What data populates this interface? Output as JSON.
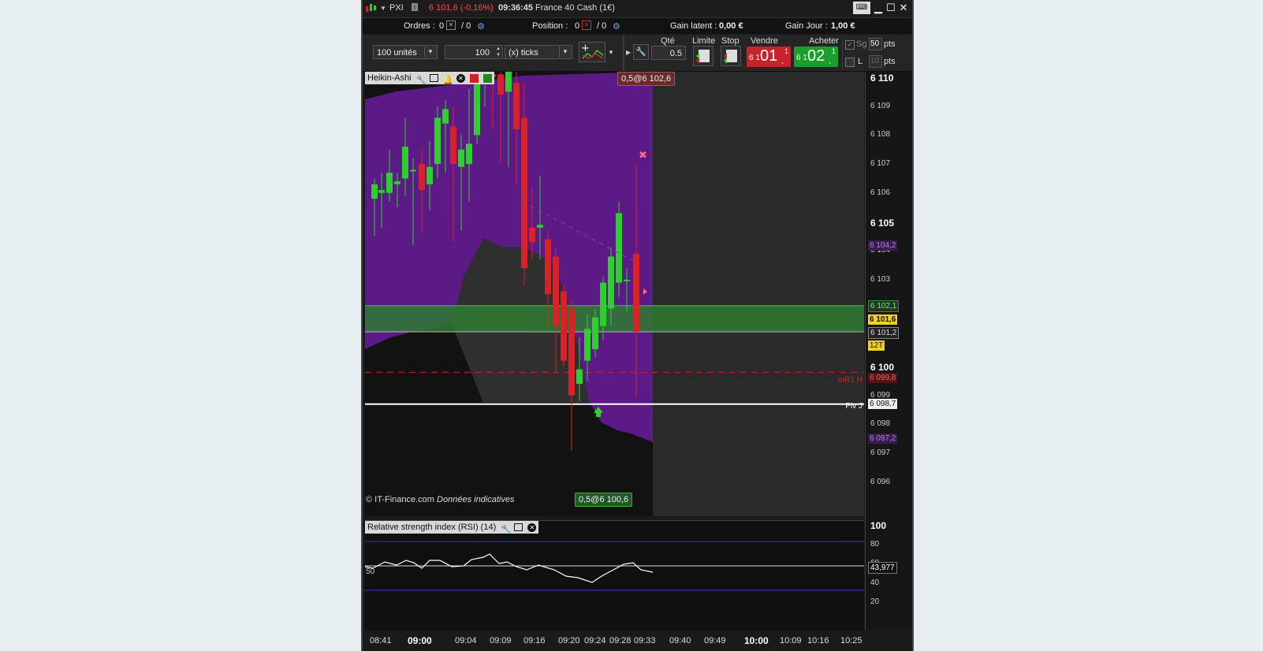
{
  "titlebar": {
    "app": "PXI",
    "price_change": "6 101,6 (-0,16%)",
    "time": "09:36:45",
    "instrument": "France 40 Cash (1€)"
  },
  "status": {
    "orders_label": "Ordres :",
    "orders_a": "0",
    "orders_b": "/ 0",
    "position_label": "Position :",
    "position_a": "0",
    "position_b": "/ 0",
    "gain_latent_label": "Gain latent :",
    "gain_latent_value": "0,00 €",
    "gain_jour_label": "Gain Jour :",
    "gain_jour_value": "1,00 €"
  },
  "toolbar": {
    "units_select": "100 unités",
    "step_value": "100",
    "ticks_select": "(x) ticks",
    "qty_label": "Qté",
    "qty_value": "0.5",
    "limit_label": "Limite",
    "stop_label": "Stop",
    "sell_label": "Vendre",
    "buy_label": "Acheter",
    "sell_prefix": "6 1",
    "sell_big": "01",
    "sell_small": "1",
    "buy_prefix": "6 1",
    "buy_big": "02",
    "buy_small": "1",
    "sg_label": "Sg",
    "sg_value": "50",
    "pts1": "pts",
    "l_label": "L",
    "l_value": "10",
    "pts2": "pts"
  },
  "chart": {
    "indicator_label": "Heikin-Ashi",
    "order_tag_top": "0,5@6 102,6",
    "order_tag_bottom": "0,5@6 100,6",
    "copyright": "© IT-Finance.com",
    "disclaimer": "Données indicatives",
    "mr1_label": "mR1 H",
    "piv_label": "Piv J",
    "colors": {
      "bull": "#2fcf2f",
      "bear": "#d8222a",
      "cloud": "#5b1a85",
      "zone": "#2e7a32"
    }
  },
  "price_axis": {
    "labels": [
      {
        "v": "6 110",
        "bold": true
      },
      {
        "v": "6 109"
      },
      {
        "v": "6 108"
      },
      {
        "v": "6 107"
      },
      {
        "v": "6 106"
      },
      {
        "v": "6 105",
        "bold": true
      },
      {
        "v": "6 104"
      },
      {
        "v": "6 103"
      },
      {
        "v": "6 102"
      },
      {
        "v": "6 101"
      },
      {
        "v": "6 100",
        "bold": true
      },
      {
        "v": "6 099"
      },
      {
        "v": "6 098"
      },
      {
        "v": "6 097"
      },
      {
        "v": "6 096"
      }
    ],
    "box_1042": "6 104,2",
    "box_1021": "6 102,1",
    "box_1016": "6 101,6",
    "box_1012": "6 101,2",
    "timer": "12T",
    "box_0998": "6 099,8",
    "box_0987": "6 098,7",
    "box_0972": "6 097,2"
  },
  "rsi": {
    "label": "Relative strength index (RSI) (14)",
    "level_50": "50",
    "axis": [
      "100",
      "80",
      "60",
      "40",
      "20"
    ],
    "current": "43,977"
  },
  "time_axis": {
    "labels": [
      {
        "v": "08:41"
      },
      {
        "v": "09:00",
        "bold": true
      },
      {
        "v": "09:04"
      },
      {
        "v": "09:09"
      },
      {
        "v": "09:16"
      },
      {
        "v": "09:20"
      },
      {
        "v": "09:24"
      },
      {
        "v": "09:28"
      },
      {
        "v": "09:33"
      },
      {
        "v": "09:40"
      },
      {
        "v": "09:49"
      },
      {
        "v": "10:00",
        "bold": true
      },
      {
        "v": "10:09"
      },
      {
        "v": "10:16"
      },
      {
        "v": "10:25"
      }
    ]
  }
}
